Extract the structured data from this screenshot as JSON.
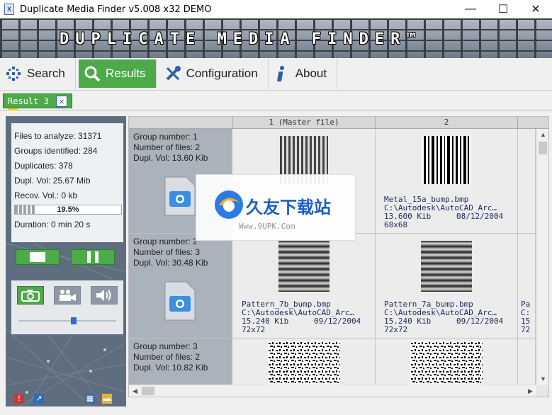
{
  "window": {
    "title": "Duplicate Media Finder  v5.008  x32  DEMO",
    "app_icon": "X",
    "minimize": "—",
    "maximize": "☐",
    "close": "✕"
  },
  "banner": {
    "text": "DUPLICATE MEDIA FINDER™"
  },
  "toolbar": {
    "search": "Search",
    "results": "Results",
    "configuration": "Configuration",
    "about": "About"
  },
  "tabs": [
    {
      "label": "Result 3",
      "close": "✕"
    }
  ],
  "stats": {
    "files_to_analyze": "Files to analyze: 31371",
    "groups_identified": "Groups identified: 284",
    "duplicates": "Duplicates: 378",
    "dupl_vol": "Dupl. Vol: 25.67 Mib",
    "recov_vol": "Recov. Vol.: 0 kb",
    "progress_text": "19.5%",
    "progress_value": 0.195,
    "duration": "Duration: 0 min  20 s"
  },
  "columns": [
    "1 (Master file)",
    "2"
  ],
  "groups": [
    {
      "number": "Group number: 1",
      "files": "Number of files: 2",
      "vol": "Dupl. Vol: 13.60 Kib",
      "cells": [
        {
          "name": "",
          "path": "",
          "size": "",
          "date": "",
          "dims": ""
        },
        {
          "name": "Metal_15a_bump.bmp",
          "path": "C:\\Autodesk\\AutoCAD_Arc…",
          "size": "13.600 Kib",
          "date": "08/12/2004",
          "dims": "68x68"
        }
      ]
    },
    {
      "number": "Group number: 2",
      "files": "Number of files: 3",
      "vol": "Dupl. Vol: 30.48 Kib",
      "cells": [
        {
          "name": "Pattern_7b_bump.bmp",
          "path": "C:\\Autodesk\\AutoCAD_Arc…",
          "size": "15.240 Kib",
          "date": "09/12/2004",
          "dims": "72x72"
        },
        {
          "name": "Pattern_7a_bump.bmp",
          "path": "C:\\Autodesk\\AutoCAD_Arc…",
          "size": "15.240 Kib",
          "date": "09/12/2004",
          "dims": "72x72"
        }
      ]
    },
    {
      "number": "Group number: 3",
      "files": "Number of files: 2",
      "vol": "Dupl. Vol: 10.82 Kib",
      "cells": []
    }
  ],
  "watermark": {
    "title": "久友下载站",
    "url": "Www.9UPK.Com"
  }
}
